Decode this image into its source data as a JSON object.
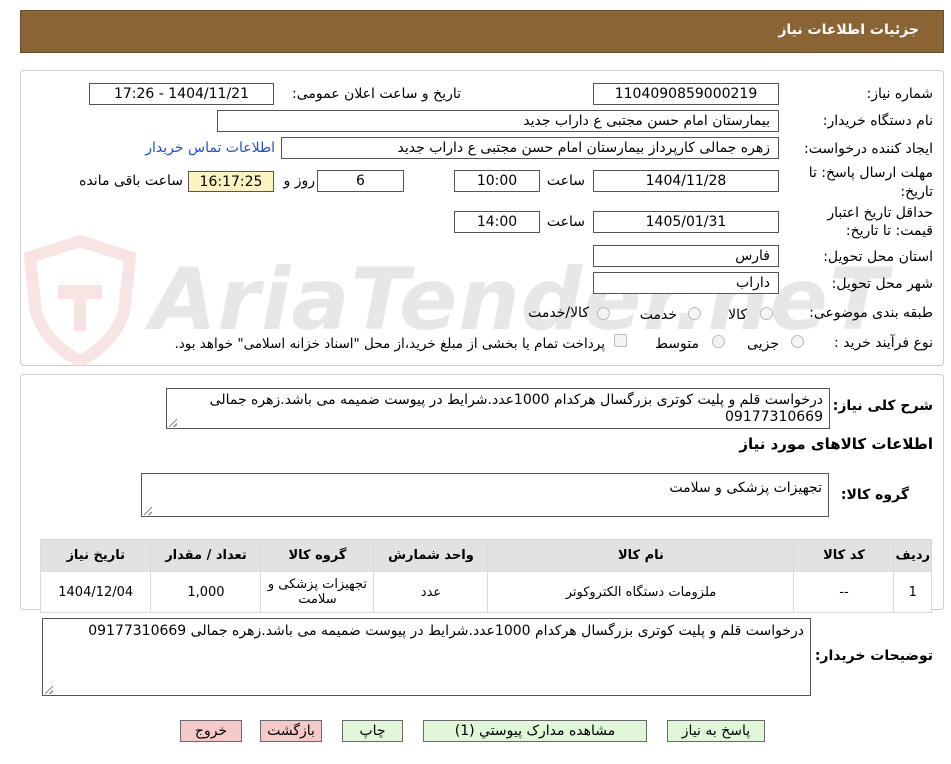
{
  "header": {
    "title": "جزئیات اطلاعات نیاز"
  },
  "watermark": {
    "text": "AriaTender.neT"
  },
  "form": {
    "need_number_label": "شماره نیاز:",
    "need_number": "1104090859000219",
    "announce_label": "تاریخ و ساعت اعلان عمومی:",
    "announce_value": "1404/11/21 - 17:26",
    "buyer_org_label": "نام دستگاه خریدار:",
    "buyer_org": "بیمارستان امام حسن مجتبی  ع  داراب جدید",
    "creator_label": "ایجاد کننده درخواست:",
    "creator": "زهره جمالی کارپرداز بیمارستان امام حسن مجتبی  ع  داراب جدید",
    "contact_link": "اطلاعات تماس خریدار",
    "deadline_label_1": "مهلت ارسال پاسخ: تا",
    "deadline_label_2": "تاریخ:",
    "deadline_date": "1404/11/28",
    "time_label": "ساعت",
    "deadline_time": "10:00",
    "days_value": "6",
    "days_label": "روز و",
    "remaining_time": "16:17:25",
    "remaining_label": "ساعت باقی مانده",
    "validity_label_1": "حداقل تاریخ اعتبار",
    "validity_label_2": "قیمت: تا تاریخ:",
    "validity_date": "1405/01/31",
    "validity_time": "14:00",
    "province_label": "استان محل تحویل:",
    "province": "فارس",
    "city_label": "شهر محل تحویل:",
    "city": "داراب",
    "category_label": "طبقه بندی موضوعی:",
    "category_options": [
      "کالا",
      "خدمت",
      "کالا/خدمت"
    ],
    "process_label": "نوع فرآیند خرید :",
    "process_options": [
      "جزیی",
      "متوسط"
    ],
    "payment_note": "پرداخت تمام یا بخشی از مبلغ خرید،از محل \"اسناد خزانه اسلامی\" خواهد بود."
  },
  "description": {
    "label": "شرح کلی نیاز:",
    "text": "درخواست قلم و پلیت کوتری بزرگسال هرکدام 1000عدد.شرایط در پیوست ضمیمه می باشد.زهره جمالی 09177310669"
  },
  "goods": {
    "section_title": "اطلاعات کالاهای مورد نیاز",
    "group_label": "گروه کالا:",
    "group_value": "تجهیزات پزشکی و سلامت",
    "columns": [
      "ردیف",
      "کد کالا",
      "نام کالا",
      "واحد شمارش",
      "گروه کالا",
      "تعداد / مقدار",
      "تاریخ نیاز"
    ],
    "rows": [
      [
        "1",
        "--",
        "ملزومات دستگاه الکتروکوتر",
        "عدد",
        "تجهیزات پزشکی و سلامت",
        "1,000",
        "1404/12/04"
      ]
    ]
  },
  "buyer_notes": {
    "label": "توضیحات خریدار:",
    "text": "درخواست قلم  و پلیت کوتری بزرگسال هرکدام 1000عدد.شرایط در پیوست ضمیمه می باشد.زهره جمالی 09177310669"
  },
  "buttons": {
    "reply": "پاسخ به نیاز",
    "attachments": "مشاهده مدارک پیوستي (1)",
    "print": "چاپ",
    "back": "بازگشت",
    "exit": "خروج"
  },
  "colors": {
    "header_bg": "#8b6436",
    "link": "#1c4fd6",
    "highlight_box": "#fbf3c0",
    "green_button": "#dff7d6",
    "red_button": "#f6c9c9"
  }
}
